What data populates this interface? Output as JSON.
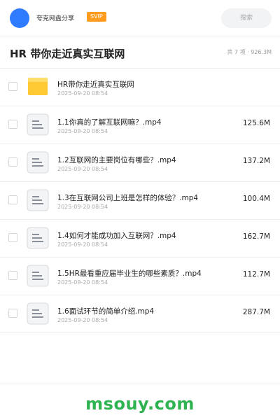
{
  "app": {
    "site_name": "夸克网盘分享",
    "badge": "SVIP",
    "search_placeholder": "搜索"
  },
  "header": {
    "title": "HR 带你走近真实互联网",
    "summary": "共 7 项 · 926.3M"
  },
  "files": [
    {
      "name": "HR带你走近真实互联网",
      "date": "2025-09-20 08:54",
      "size": "",
      "type": "folder"
    },
    {
      "name": "1.1你真的了解互联网嘛？.mp4",
      "date": "2025-09-20 08:54",
      "size": "125.6M",
      "type": "file"
    },
    {
      "name": "1.2互联网的主要岗位有哪些？.mp4",
      "date": "2025-09-20 08:54",
      "size": "137.2M",
      "type": "file"
    },
    {
      "name": "1.3在互联网公司上班是怎样的体验？.mp4",
      "date": "2025-09-20 08:54",
      "size": "100.4M",
      "type": "file"
    },
    {
      "name": "1.4如何才能成功加入互联网？.mp4",
      "date": "2025-09-20 08:54",
      "size": "162.7M",
      "type": "file"
    },
    {
      "name": "1.5HR最看重应届毕业生的哪些素质？.mp4",
      "date": "2025-09-20 08:54",
      "size": "112.7M",
      "type": "file"
    },
    {
      "name": "1.6面试环节的简单介绍.mp4",
      "date": "2025-09-20 08:54",
      "size": "287.7M",
      "type": "file"
    }
  ],
  "footer": {
    "watermark": "msouy.com"
  },
  "colors": {
    "avatar": "#2f7bff",
    "badge": "#ff9b1f",
    "folder": "#ffc933",
    "watermark": "#2fb350"
  },
  "icons": {
    "folder": "folder-icon",
    "file": "document-icon"
  }
}
